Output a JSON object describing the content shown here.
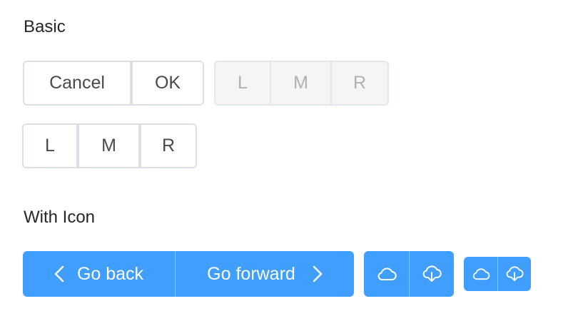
{
  "sections": {
    "basic_title": "Basic",
    "icon_title": "With Icon"
  },
  "basic": {
    "group1": {
      "cancel": "Cancel",
      "ok": "OK"
    },
    "group2": {
      "left": "L",
      "middle": "M",
      "right": "R"
    },
    "group3": {
      "left": "L",
      "middle": "M",
      "right": "R"
    }
  },
  "with_icon": {
    "nav": {
      "back": "Go back",
      "forward": "Go forward"
    },
    "icons": [
      "cloud-icon",
      "cloud-download-icon"
    ]
  },
  "colors": {
    "primary": "#409eff",
    "border": "#dcdfe6",
    "disabled_bg": "#f5f5f5"
  }
}
